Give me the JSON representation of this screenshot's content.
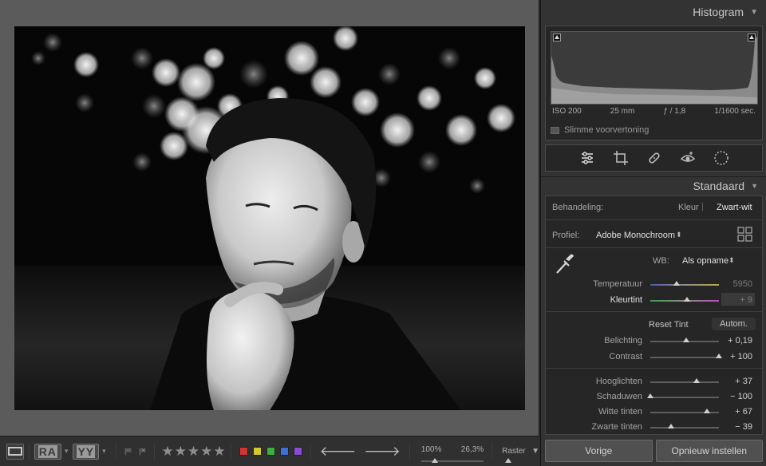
{
  "panels": {
    "histogram": {
      "title": "Histogram",
      "iso": "ISO 200",
      "focal_length": "25 mm",
      "aperture": "ƒ / 1,8",
      "shutter": "1/1600 sec.",
      "smart_preview_label": "Slimme voorvertoning"
    },
    "basic": {
      "title": "Standaard",
      "treatment_label": "Behandeling:",
      "treatment_color": "Kleur",
      "treatment_bw": "Zwart-wit",
      "profile_label": "Profiel:",
      "profile_value": "Adobe Monochroom",
      "wb_label": "WB:",
      "wb_value": "Als opname",
      "temperature_label": "Temperatuur",
      "temperature_value": "5950",
      "temperature_level": 0.38,
      "tint_label": "Kleurtint",
      "tint_value": "+ 9",
      "tint_level": 0.53,
      "reset_tint": "Reset Tint",
      "auto": "Autom.",
      "sliders": [
        {
          "label": "Belichting",
          "value": "+ 0,19",
          "level": 0.52
        },
        {
          "label": "Contrast",
          "value": "+ 100",
          "level": 1.0
        },
        {
          "label": "Hooglichten",
          "value": "+ 37",
          "level": 0.68
        },
        {
          "label": "Schaduwen",
          "value": "− 100",
          "level": 0.0
        },
        {
          "label": "Witte tinten",
          "value": "+ 67",
          "level": 0.83
        },
        {
          "label": "Zwarte tinten",
          "value": "− 39",
          "level": 0.3
        }
      ]
    }
  },
  "buttons": {
    "previous": "Vorige",
    "reset": "Opnieuw instellen"
  },
  "toolbar": {
    "ra_label": "RA",
    "yy_label": "YY",
    "zoom_left": "100%",
    "zoom_right": "26,3%",
    "zoom_level": 0.15,
    "raster_label": "Raster tonen",
    "rating_stars": 5,
    "color_labels": [
      "#d43434",
      "#d4c92a",
      "#3fae3f",
      "#3c6fd8",
      "#8a4ad4"
    ]
  }
}
